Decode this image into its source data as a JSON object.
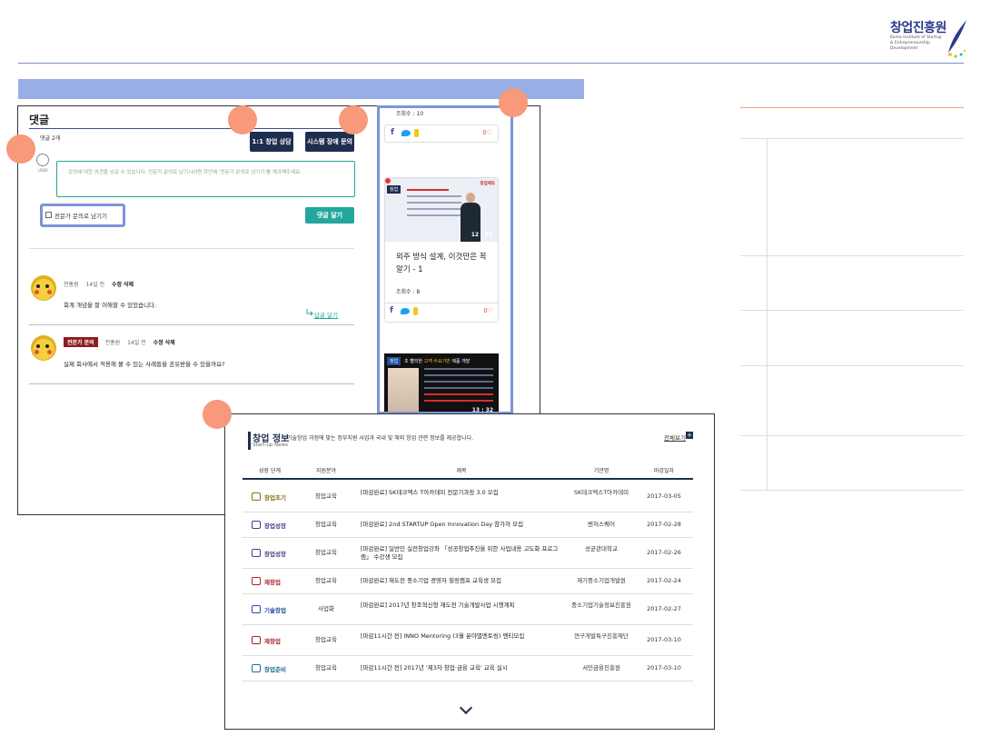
{
  "header": {
    "logo_text": "창업진흥원",
    "logo_sub": "Korea Institute of Startup & Entrepreneurship Development"
  },
  "comments": {
    "title": "댓글",
    "count_label": "댓글 2개",
    "consult_button": "1:1 창업 상담",
    "report_button": "시스템 장애 문의",
    "avatar_label": "USER",
    "placeholder": "강의에 대한 의견을 남길 수 있습니다. 전문가 문의로 남기시려면 하단에 '전문가 문의로 남기기'를 체크해주세요.",
    "expert_checkbox_label": "전문가 문의로 남기기",
    "submit_button": "댓글 달기",
    "reply_link": "답글 달기",
    "items": [
      {
        "author": "전홍원",
        "time": "14일 전",
        "edit": "수정",
        "delete": "삭제",
        "text": "회계 개념을 잘 이해할 수 있었습니다."
      },
      {
        "badge": "전문가 문의",
        "author": "전홍원",
        "time": "14일 전",
        "edit": "수정",
        "delete": "삭제",
        "text": "실제 회사에서 적용해 볼 수 있는 사례들을 공유받을 수 있을까요?"
      }
    ]
  },
  "videos": {
    "top_views": "조회수 : 10",
    "top_likes": "0♡",
    "card": {
      "tag": "창업",
      "brand": "창업에듀",
      "duration": "12 : 37",
      "title": "외주 방식 설계, 이것만은 꼭 알기 - 1",
      "views": "조회수 : 8",
      "likes": "0♡"
    },
    "bottom": {
      "tag": "창업",
      "headline_pre": "초 빨리한",
      "headline_em": "고객 수요기반",
      "headline_post": "제품 개발",
      "duration": "13 : 32"
    }
  },
  "startup_info": {
    "title": "창업 정보",
    "description": "기술창업 과정에 맞는 정부지원 사업과 국내 및 해외 창업 관련 정보를 제공합니다.",
    "subtitle": "Start-up News",
    "view_all": "전체보기",
    "columns": [
      "성장 단계",
      "지원분야",
      "제목",
      "기관명",
      "마감일자"
    ],
    "rows": [
      {
        "stage": "창업초기",
        "stage_color": "#8a6d1f",
        "field": "창업교육",
        "title": "[마감완료] SK테크엑스 T아카데미 전문기과정 3.0 모집",
        "org": "SK테크엑스T아카데미",
        "date": "2017-03-05"
      },
      {
        "stage": "창업성장",
        "stage_color": "#4b3a8c",
        "field": "창업교육",
        "title": "[마감완료] 2nd STARTUP Open Innovation Day 참가자 모집",
        "org": "벤처스퀘어",
        "date": "2017-02-28"
      },
      {
        "stage": "창업성장",
        "stage_color": "#4b3a8c",
        "field": "창업교육",
        "title": "[마감완료] 일반인 실전창업강좌 「성공창업추진을 위한 사업내용 고도화 프로그램」 수강생 모집",
        "org": "성균관대학교",
        "date": "2017-02-26"
      },
      {
        "stage": "재창업",
        "stage_color": "#a1272b",
        "field": "창업교육",
        "title": "[마감완료] 재도전 중소기업 경영자 힐링캠프 교육생 모집",
        "org": "재기중소기업개발원",
        "date": "2017-02-24"
      },
      {
        "stage": "기술창업",
        "stage_color": "#1e4fa1",
        "field": "사업화",
        "title": "[마감완료] 2017년 창조혁신형 재도전 기술개발사업 시행계획",
        "org": "중소기업기술정보진흥원",
        "date": "2017-02-27"
      },
      {
        "stage": "재창업",
        "stage_color": "#a1272b",
        "field": "창업교육",
        "title": "[마감11시간 전] INNO Mentoring (3월 분야별멘토링) 멘티모집",
        "org": "연구개발특구진흥재단",
        "date": "2017-03-10"
      },
      {
        "stage": "창업준비",
        "stage_color": "#1e6f8c",
        "field": "창업교육",
        "title": "[마감11시간 전] 2017년 '제3차 창업·금융 교육' 교육 실시",
        "org": "서민금융진흥원",
        "date": "2017-03-10"
      }
    ]
  },
  "colors": {
    "accent_teal": "#23a79c",
    "navy": "#1e2e4f",
    "highlight_blue": "#7e93d9",
    "marker_orange": "#f7997a"
  }
}
